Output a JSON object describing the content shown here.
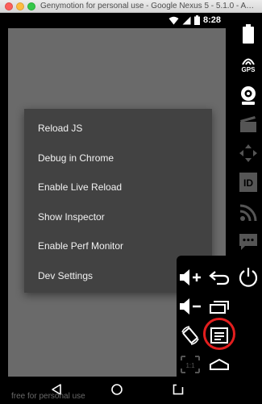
{
  "window": {
    "title": "Genymotion for personal use - Google Nexus 5 - 5.1.0 - API..."
  },
  "device": {
    "status_time": "8:28",
    "status_icons": [
      "wifi-icon",
      "signal-icon",
      "battery-icon"
    ],
    "nav_icons": [
      "back-icon",
      "home-icon",
      "recents-icon"
    ]
  },
  "dev_menu": {
    "items": [
      {
        "label": "Reload JS"
      },
      {
        "label": "Debug in Chrome"
      },
      {
        "label": "Enable Live Reload"
      },
      {
        "label": "Show Inspector"
      },
      {
        "label": "Enable Perf Monitor"
      },
      {
        "label": "Dev Settings"
      }
    ]
  },
  "toolbar": {
    "gps_label": "GPS",
    "id_label": "ID",
    "icons": [
      "battery-icon",
      "gps-icon",
      "camera-icon",
      "clapperboard-icon",
      "dpad-icon",
      "id-icon",
      "rss-icon",
      "chat-icon"
    ]
  },
  "controls_panel": {
    "icons": [
      "volume-up-icon",
      "back-arrow-icon",
      "power-icon",
      "volume-down-icon",
      "recent-apps-icon",
      "rotate-icon",
      "menu-icon",
      "scale-icon",
      "home-roof-icon"
    ],
    "scale_label": "1:1",
    "highlight_color": "#e31e1e"
  },
  "watermark": {
    "text": "free for personal use"
  },
  "colors": {
    "app_background": "#6a6a6a",
    "dialog_background": "#424242"
  }
}
